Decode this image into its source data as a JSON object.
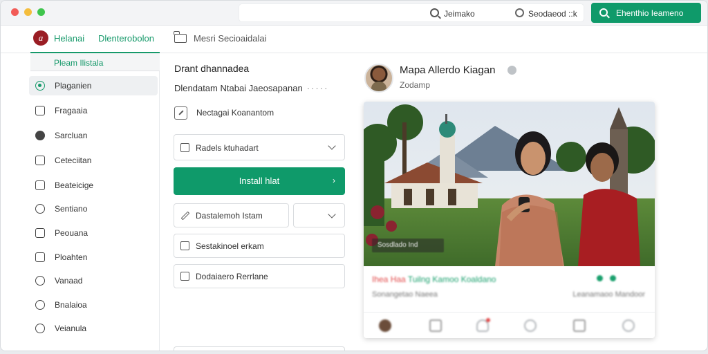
{
  "titlebar": {
    "search_text": "Jeimako",
    "secondary_text": "Seodaeod ::k",
    "cta_label": "Ehenthio Ieameno"
  },
  "nav": {
    "brand": "Helanai",
    "link": "Dlenterobolon",
    "meta": "Mesri Secioaidalai"
  },
  "sidebar": {
    "sub_label": "Pleam Ilistala",
    "items": [
      {
        "label": "Plaganien",
        "icon": "radio-icon",
        "active": true
      },
      {
        "label": "Fragaaia",
        "icon": "grid-icon"
      },
      {
        "label": "Sarcluan",
        "icon": "disc-icon"
      },
      {
        "label": "Ceteciitan",
        "icon": "scan-icon"
      },
      {
        "label": "Beateicige",
        "icon": "calendar-icon"
      },
      {
        "label": "Sentiano",
        "icon": "chat-icon"
      },
      {
        "label": "Peouana",
        "icon": "box-icon"
      },
      {
        "label": "Ploahten",
        "icon": "edit-icon"
      },
      {
        "label": "Vanaad",
        "icon": "user-icon"
      },
      {
        "label": "Bnalaioa",
        "icon": "person-icon"
      },
      {
        "label": "Veianula",
        "icon": "clock-icon"
      }
    ]
  },
  "form": {
    "title": "Drant dhannadea",
    "subtitle": "Dlendatam Ntabai Jaeosapanan",
    "checkbox_label": "Nectagai Koanantom",
    "dropdown_label": "Radels ktuhadart",
    "install_label": "Install hlat",
    "field_label": "Dastalemoh Istam",
    "field2_label": "Sestakinoel erkam",
    "field3_label": "Dodaiaero Rerrlane"
  },
  "post": {
    "author": "Mapa Allerdo Kiagan",
    "date": "Zodamp",
    "caption": "Sosdlado Ind",
    "meta_red": "Ihea Haa",
    "meta_green": "Tuilng Kamoo Koaldano",
    "meta_sub": "Sonangetao Naeea",
    "meta_sub_right": "Leanamaoo Mandoor"
  }
}
